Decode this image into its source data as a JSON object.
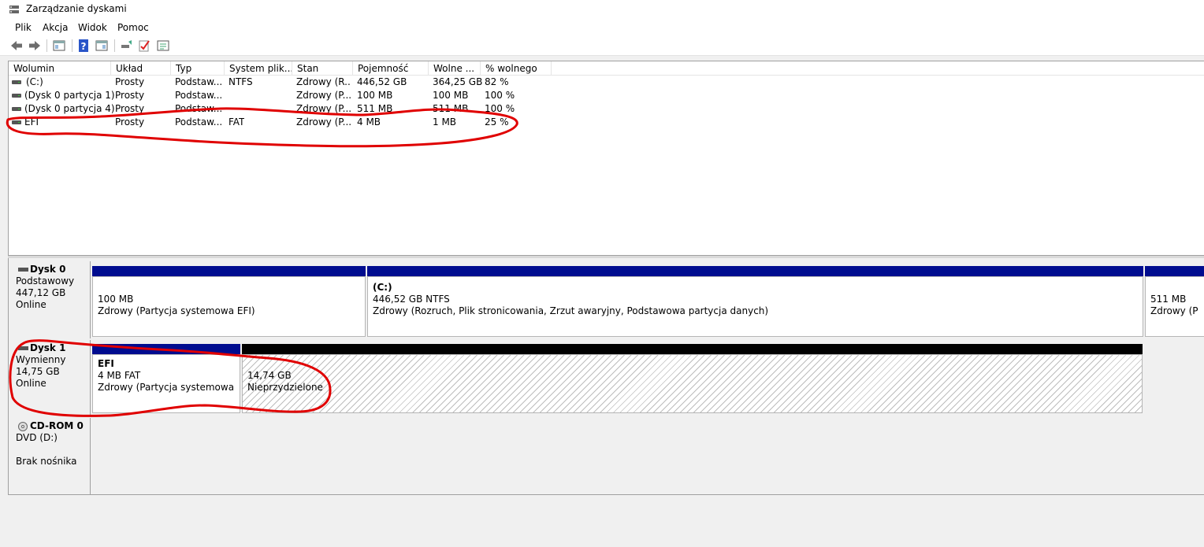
{
  "window": {
    "title": "Zarządzanie dyskami"
  },
  "menu": [
    "Plik",
    "Akcja",
    "Widok",
    "Pomoc"
  ],
  "toolbar": [
    "back-icon",
    "forward-icon",
    "console-tree-icon",
    "help-icon",
    "properties-icon",
    "connect-icon",
    "check-icon",
    "list-icon"
  ],
  "columns": [
    "Wolumin",
    "Układ",
    "Typ",
    "System plik...",
    "Stan",
    "Pojemność",
    "Wolne ...",
    "% wolnego"
  ],
  "volumes": [
    {
      "name": "(C:)",
      "layout": "Prosty",
      "type": "Podstaw...",
      "fs": "NTFS",
      "status": "Zdrowy (R...",
      "capacity": "446,52 GB",
      "free": "364,25 GB",
      "pct": "82 %"
    },
    {
      "name": "(Dysk 0 partycja 1)",
      "layout": "Prosty",
      "type": "Podstaw...",
      "fs": "",
      "status": "Zdrowy (P...",
      "capacity": "100 MB",
      "free": "100 MB",
      "pct": "100 %"
    },
    {
      "name": "(Dysk 0 partycja 4)",
      "layout": "Prosty",
      "type": "Podstaw...",
      "fs": "",
      "status": "Zdrowy (P...",
      "capacity": "511 MB",
      "free": "511 MB",
      "pct": "100 %"
    },
    {
      "name": "EFI",
      "layout": "Prosty",
      "type": "Podstaw...",
      "fs": "FAT",
      "status": "Zdrowy (P...",
      "capacity": "4 MB",
      "free": "1 MB",
      "pct": "25 %"
    }
  ],
  "disks": [
    {
      "name": "Dysk 0",
      "kind": "Podstawowy",
      "size": "447,12 GB",
      "state": "Online",
      "partitions": [
        {
          "title": "",
          "line1": "100 MB",
          "line2": "Zdrowy (Partycja systemowa EFI)"
        },
        {
          "title": "(C:)",
          "line1": "446,52 GB NTFS",
          "line2": "Zdrowy (Rozruch, Plik stronicowania, Zrzut awaryjny, Podstawowa partycja danych)"
        },
        {
          "title": "",
          "line1": "511 MB",
          "line2": "Zdrowy (P"
        }
      ]
    },
    {
      "name": "Dysk 1",
      "kind": "Wymienny",
      "size": "14,75 GB",
      "state": "Online",
      "partitions": [
        {
          "title": "EFI",
          "line1": "4 MB FAT",
          "line2": "Zdrowy (Partycja systemowa EFI)"
        },
        {
          "title": "",
          "line1": "14,74 GB",
          "line2": "Nieprzydzielone"
        }
      ]
    },
    {
      "name": "CD-ROM 0",
      "kind": "DVD (D:)",
      "size": "",
      "state": "Brak nośnika"
    }
  ],
  "colors": {
    "primary_bar": "#000c8f",
    "unallocated_bar": "#000000",
    "annotation": "#e00000",
    "selection": "#0078d7"
  }
}
